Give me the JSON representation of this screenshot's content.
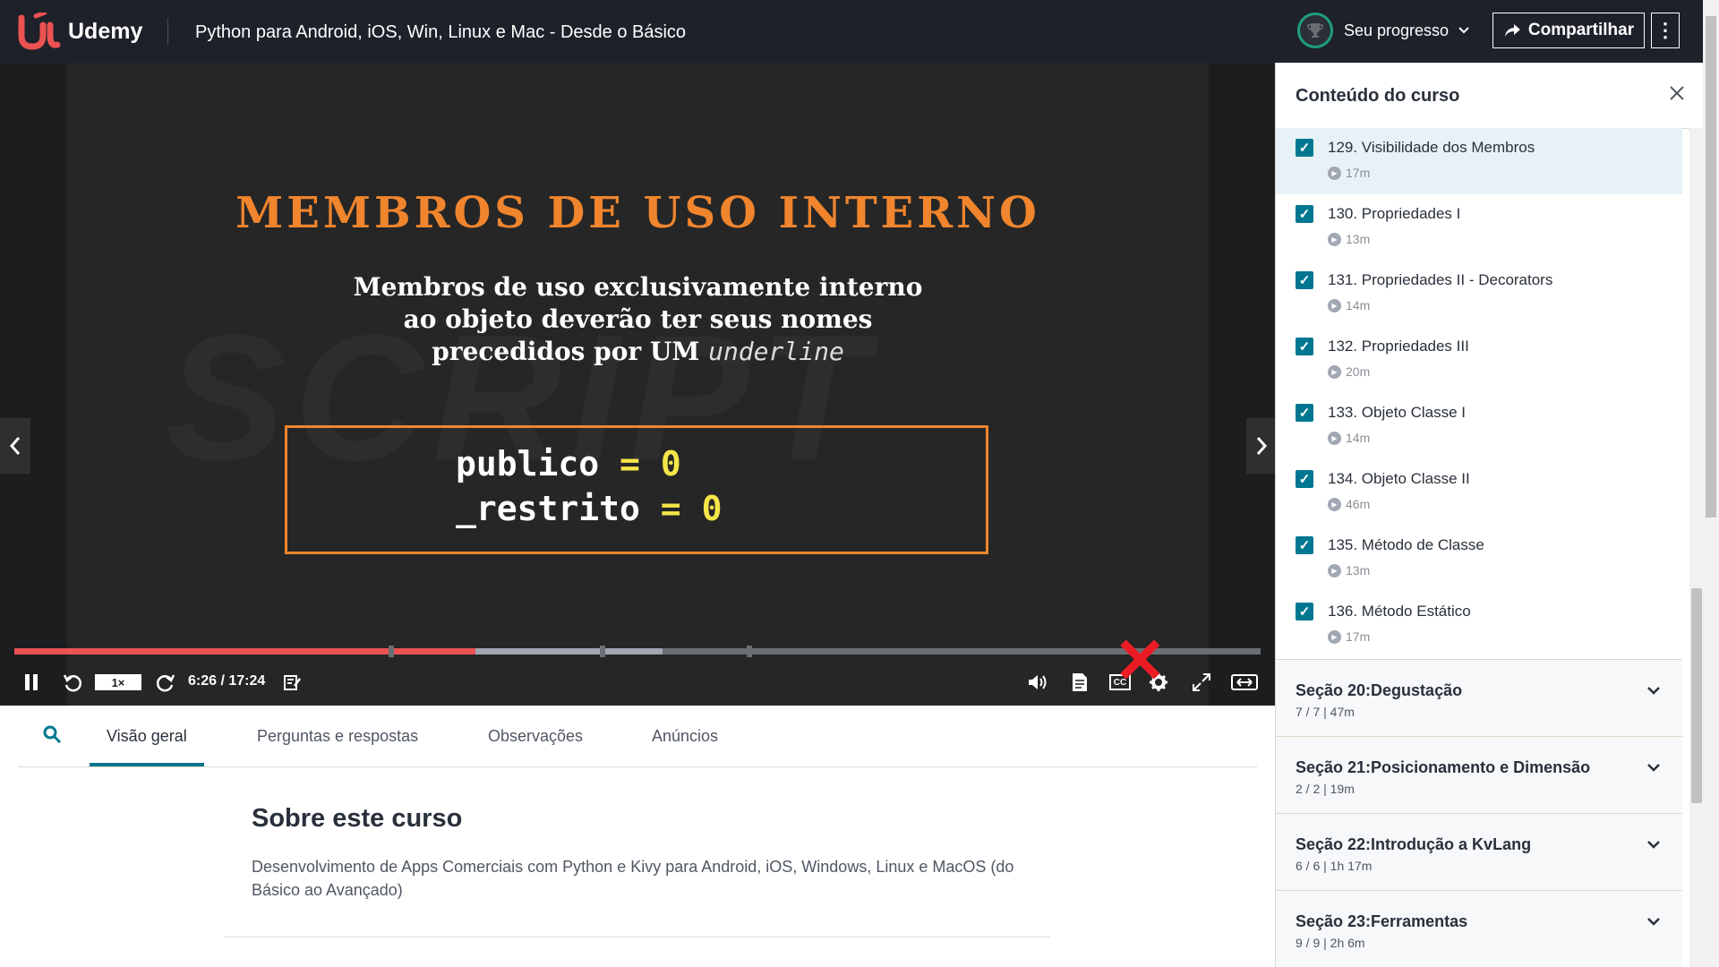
{
  "header": {
    "brand": "Udemy",
    "course_title": "Python para Android, iOS, Win, Linux e Mac - Desde o Básico",
    "progress_label": "Seu progresso",
    "share_label": "Compartilhar",
    "more_label": "⋮"
  },
  "slide": {
    "title": "MEMBROS DE USO INTERNO",
    "line1": "Membros de uso exclusivamente interno",
    "line2": "ao objeto deverão ter seus nomes",
    "line3_prefix": "precedidos por UM",
    "line3_italic": "underline",
    "code": [
      {
        "name": "publico",
        "eq": "=",
        "val": "0"
      },
      {
        "name": "_restrito",
        "eq": "=",
        "val": "0"
      }
    ],
    "watermark": "SCRIPT"
  },
  "player": {
    "progress": 0.37,
    "buffered_to": 0.52,
    "speed": "1×",
    "time": "6:26 / 17:24",
    "cc_label": "CC"
  },
  "tabs": [
    {
      "label": "Visão geral"
    },
    {
      "label": "Perguntas e respostas"
    },
    {
      "label": "Observações"
    },
    {
      "label": "Anúncios"
    }
  ],
  "about": {
    "title": "Sobre este curso",
    "description": "Desenvolvimento de Apps Comerciais com Python e Kivy para Android, iOS, Windows, Linux e MacOS (do Básico ao Avançado)"
  },
  "sidebar": {
    "title": "Conteúdo do curso",
    "lectures": [
      {
        "title": "129. Visibilidade dos Membros",
        "duration": "17m"
      },
      {
        "title": "130. Propriedades I",
        "duration": "13m"
      },
      {
        "title": "131. Propriedades II - Decorators",
        "duration": "14m"
      },
      {
        "title": "132. Propriedades III",
        "duration": "20m"
      },
      {
        "title": "133. Objeto Classe I",
        "duration": "14m"
      },
      {
        "title": "134. Objeto Classe II",
        "duration": "46m"
      },
      {
        "title": "135. Método de Classe",
        "duration": "13m"
      },
      {
        "title": "136. Método Estático",
        "duration": "17m"
      }
    ],
    "sections": [
      {
        "title": "Seção 20:Degustação",
        "meta": "7 / 7 | 47m"
      },
      {
        "title": "Seção 21:Posicionamento e Dimensão",
        "meta": "2 / 2 | 19m"
      },
      {
        "title": "Seção 22:Introdução a KvLang",
        "meta": "6 / 6 | 1h 17m"
      },
      {
        "title": "Seção 23:Ferramentas",
        "meta": "9 / 9 | 2h 6m"
      }
    ]
  }
}
